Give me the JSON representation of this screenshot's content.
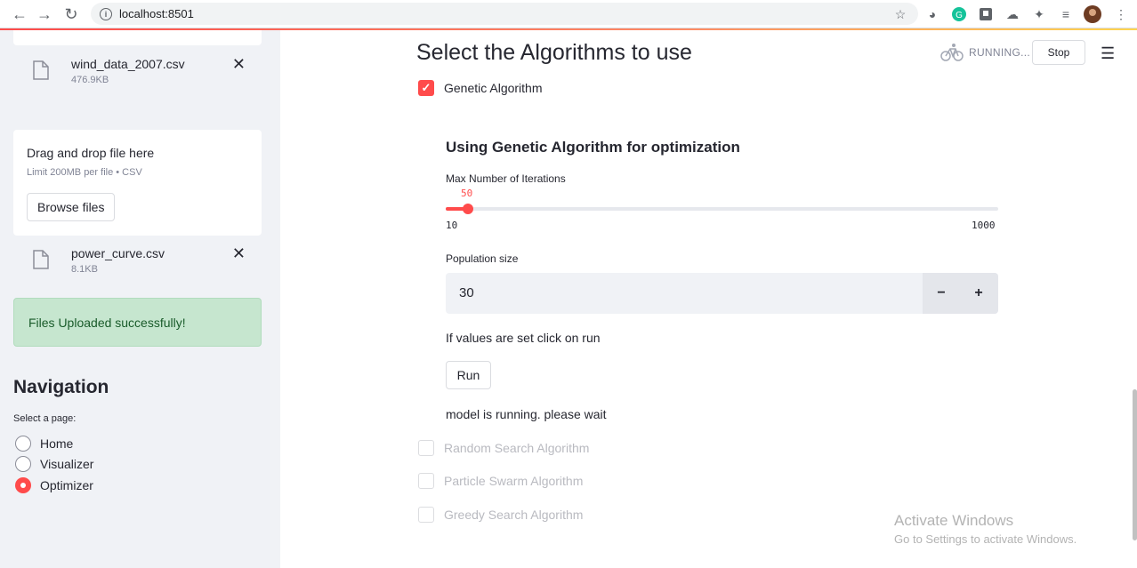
{
  "browser": {
    "url": "localhost:8501",
    "back_icon": "arrow-left-icon",
    "forward_icon": "arrow-right-icon",
    "reload_icon": "reload-icon"
  },
  "sidebar": {
    "files": [
      {
        "name": "wind_data_2007.csv",
        "size": "476.9KB"
      },
      {
        "name": "power_curve.csv",
        "size": "8.1KB"
      }
    ],
    "uploader": {
      "title": "Drag and drop file here",
      "limit": "Limit 200MB per file • CSV",
      "button": "Browse files"
    },
    "success_message": "Files Uploaded successfully!",
    "navigation": {
      "title": "Navigation",
      "label": "Select a page:",
      "options": [
        "Home",
        "Visualizer",
        "Optimizer"
      ],
      "selected": "Optimizer"
    }
  },
  "main": {
    "title": "Select the Algorithms to use",
    "status": "RUNNING...",
    "stop_label": "Stop",
    "algorithms": [
      {
        "label": "Genetic Algorithm",
        "checked": true,
        "disabled": false
      },
      {
        "label": "Random Search Algorithm",
        "checked": false,
        "disabled": true
      },
      {
        "label": "Particle Swarm Algorithm",
        "checked": false,
        "disabled": true
      },
      {
        "label": "Greedy Search Algorithm",
        "checked": false,
        "disabled": true
      }
    ],
    "ga": {
      "subtitle": "Using Genetic Algorithm for optimization",
      "iterations_label": "Max Number of Iterations",
      "iterations_value": "50",
      "iterations_min": "10",
      "iterations_max": "1000",
      "population_label": "Population size",
      "population_value": "30",
      "minus": "−",
      "plus": "+",
      "hint": "If values are set click on run",
      "run_label": "Run",
      "running_message": "model is running. please wait"
    }
  },
  "watermark": {
    "title": "Activate Windows",
    "subtitle": "Go to Settings to activate Windows."
  },
  "colors": {
    "accent": "#ff4b4b",
    "sidebar_bg": "#f0f2f6",
    "success_bg": "#c6e6cf"
  }
}
